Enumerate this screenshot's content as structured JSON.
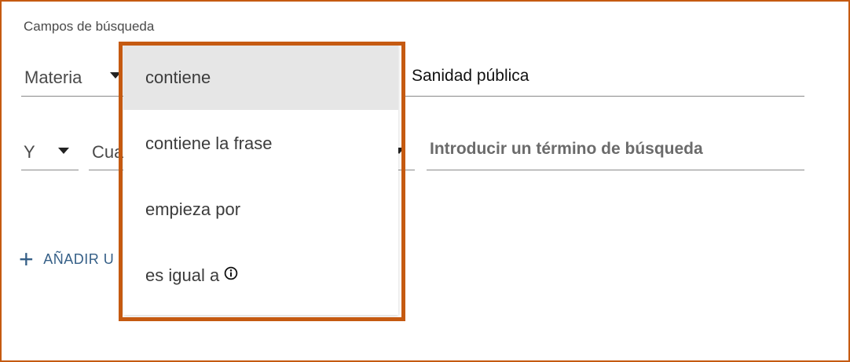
{
  "section_label": "Campos de búsqueda",
  "row1": {
    "field": "Materia",
    "value": "Sanidad pública"
  },
  "row2": {
    "operator": "Y",
    "field": "Cua",
    "term_placeholder": "Introducir un término de búsqueda"
  },
  "add_link": "AÑADIR U",
  "dropdown": {
    "options": [
      {
        "label": "contiene",
        "selected": true
      },
      {
        "label": "contiene la frase"
      },
      {
        "label": "empieza por"
      },
      {
        "label": "es igual a",
        "icon": "info-icon"
      }
    ]
  },
  "colors": {
    "highlight": "#c55a11",
    "link": "#355f87",
    "selected_bg": "#e6e6e6"
  }
}
